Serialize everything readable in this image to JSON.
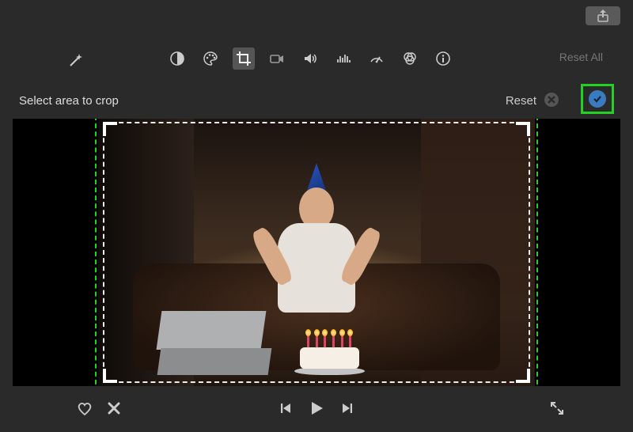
{
  "titlebar": {
    "share_button": "share-icon"
  },
  "toolbar": {
    "wand_label": "auto-enhance",
    "items": [
      {
        "name": "color-balance",
        "label": "Color Balance"
      },
      {
        "name": "color-palette",
        "label": "Color Correction"
      },
      {
        "name": "crop",
        "label": "Crop",
        "active": true
      },
      {
        "name": "stabilize",
        "label": "Stabilization"
      },
      {
        "name": "volume",
        "label": "Volume"
      },
      {
        "name": "noise-reduce",
        "label": "Noise Reduction"
      },
      {
        "name": "speed",
        "label": "Speed"
      },
      {
        "name": "color-filter",
        "label": "Clip Filter"
      },
      {
        "name": "info",
        "label": "Info"
      }
    ],
    "reset_all_label": "Reset All"
  },
  "crop": {
    "instruction_label": "Select area to crop",
    "reset_label": "Reset",
    "cancel_label": "Cancel",
    "confirm_label": "Apply"
  },
  "playback": {
    "prev_label": "Previous Frame",
    "play_label": "Play",
    "next_label": "Next Frame",
    "favorite_label": "Favorite",
    "reject_label": "Reject",
    "fullscreen_label": "Fullscreen"
  },
  "colors": {
    "highlight": "#1fd31f",
    "confirm_fill": "#3a7abf"
  }
}
